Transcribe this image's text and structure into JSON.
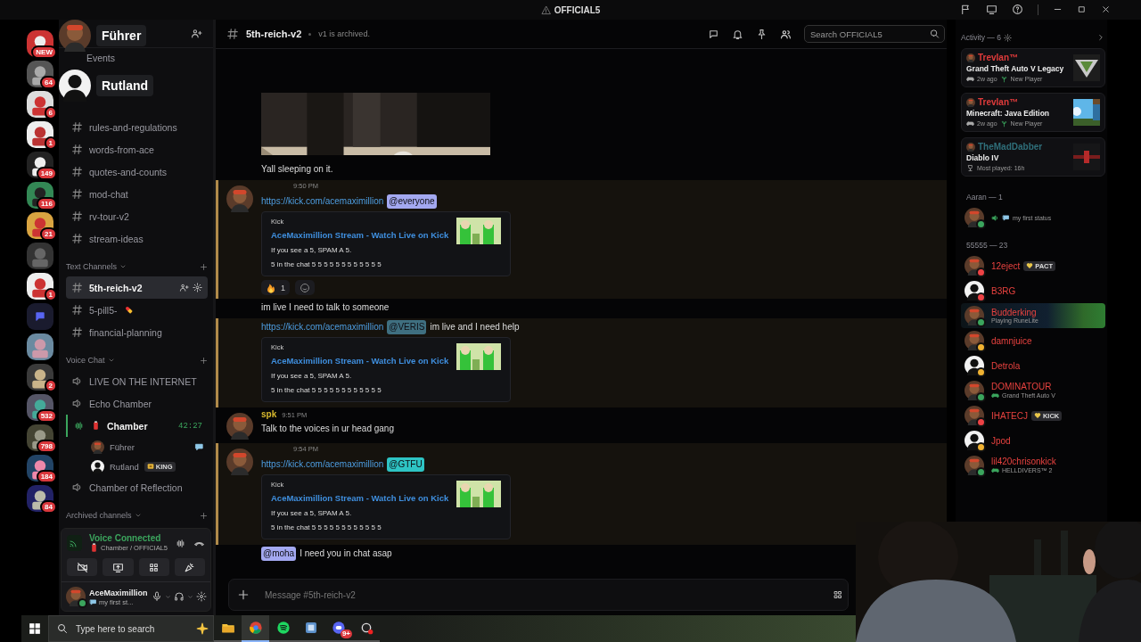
{
  "window": {
    "title": "OFFICIAL5"
  },
  "stream_overlay": {
    "speakers": [
      {
        "name": "Führer"
      },
      {
        "name": "Rutland",
        "kind": "silhouette"
      }
    ]
  },
  "servers": [
    {
      "kind": "server",
      "badge": "NEW"
    },
    {
      "kind": "server",
      "badge": "64"
    },
    {
      "kind": "server",
      "badge": "6"
    },
    {
      "kind": "server",
      "badge": "1"
    },
    {
      "kind": "server",
      "badge": "149"
    },
    {
      "kind": "server",
      "badge": "116"
    },
    {
      "kind": "server",
      "badge": "21"
    },
    {
      "kind": "server"
    },
    {
      "kind": "server",
      "badge": "1"
    },
    {
      "kind": "folder"
    },
    {
      "kind": "server"
    },
    {
      "kind": "server",
      "badge": "2"
    },
    {
      "kind": "server",
      "badge": "532"
    },
    {
      "kind": "server",
      "badge": "798"
    },
    {
      "kind": "server",
      "badge": "184"
    },
    {
      "kind": "server",
      "badge": "84"
    }
  ],
  "sidebar": {
    "events": "Events",
    "channels": [
      {
        "name": "rules-and-regulations",
        "selected": false
      },
      {
        "name": "words-from-ace",
        "selected": false
      },
      {
        "name": "quotes-and-counts",
        "selected": false
      },
      {
        "name": "mod-chat",
        "selected": false
      },
      {
        "name": "rv-tour-v2",
        "selected": false
      },
      {
        "name": "stream-ideas",
        "selected": false
      }
    ],
    "categories": [
      {
        "name": "Text Channels",
        "kind": "text",
        "channels": [
          {
            "name": "5th-reich-v2",
            "selected": true
          },
          {
            "name": "5-pill5-",
            "kind": "pill",
            "selected": false
          },
          {
            "name": "financial-planning",
            "selected": false
          }
        ]
      },
      {
        "name": "Voice Chat",
        "kind": "voice",
        "channels": [
          {
            "name": "LIVE ON THE INTERNET",
            "active": false
          },
          {
            "name": "Echo Chamber",
            "active": false
          },
          {
            "name": "Chamber",
            "kind": "battery",
            "active": true,
            "time": "42:27",
            "users": [
              {
                "name": "Führer",
                "chatting": true
              },
              {
                "name": "Rutland",
                "tag": "KING",
                "chatting": false
              }
            ]
          },
          {
            "name": "Chamber of Reflection",
            "active": false
          }
        ]
      },
      {
        "name": "Archived channels",
        "kind": "text"
      }
    ],
    "voice_panel": {
      "status": "Voice Connected",
      "location": "Chamber / OFFICIAL5"
    },
    "user": {
      "name": "AceMaximillion",
      "status": "my first st..."
    }
  },
  "chat": {
    "channel": "5th-reich-v2",
    "topic": "v1 is archived.",
    "search": {
      "placeholder": "Search OFFICIAL5"
    },
    "messages": [
      {
        "highlighted": false,
        "content": [
          {
            "kind": "text",
            "text": "Yall sleeping on it."
          }
        ]
      },
      {
        "kind": "post",
        "highlighted": true,
        "time": "9:50 PM",
        "content": [
          {
            "kind": "link",
            "text": "https://kick.com/acemaximillion"
          },
          {
            "kind": "mention",
            "text": "@everyone",
            "color": "#a3a8f0"
          }
        ],
        "embed": {
          "provider": "Kick",
          "title": "AceMaximillion Stream - Watch Live on Kick",
          "lines": [
            "If you see a 5, SPAM A 5.",
            "5 in the chat 5 5 5 5 5 5 5 5 5 5 5 5"
          ]
        },
        "reactions": [
          {
            "kind": "fire",
            "count": "1"
          }
        ]
      },
      {
        "kind": "line",
        "highlighted": false,
        "content": [
          {
            "kind": "text",
            "text": "im live I need to talk to someone"
          }
        ]
      },
      {
        "kind": "line",
        "highlighted": true,
        "content": [
          {
            "kind": "link",
            "text": "https://kick.com/acemaximillion"
          },
          {
            "kind": "mention",
            "text": "@VERIS",
            "color": "#3f6f80"
          },
          {
            "kind": "text",
            "text": "im live and I need help"
          }
        ],
        "embed": {
          "provider": "Kick",
          "title": "AceMaximillion Stream - Watch Live on Kick",
          "lines": [
            "If you see a 5, SPAM A 5.",
            "5 in the chat 5 5 5 5 5 5 5 5 5 5 5 5"
          ]
        }
      },
      {
        "kind": "post",
        "highlighted": false,
        "author": "spk",
        "color": "#d8b92e",
        "time": "9:51 PM",
        "content": [
          {
            "kind": "text",
            "text": "Talk to the voices in ur head gang"
          }
        ]
      },
      {
        "kind": "post",
        "highlighted": true,
        "time": "9:54 PM",
        "content": [
          {
            "kind": "link",
            "text": "https://kick.com/acemaximillion"
          },
          {
            "kind": "mention",
            "text": "@GTFU",
            "color": "#2ec4c4"
          }
        ],
        "embed": {
          "provider": "Kick",
          "title": "AceMaximillion Stream - Watch Live on Kick",
          "lines": [
            "If you see a 5, SPAM A 5.",
            "5 in the chat 5 5 5 5 5 5 5 5 5 5 5 5"
          ]
        }
      },
      {
        "kind": "line",
        "highlighted": false,
        "content": [
          {
            "kind": "mention",
            "text": "@moha",
            "color": "#a3a8f0"
          },
          {
            "kind": "text",
            "text": "I need you in chat asap"
          }
        ]
      }
    ],
    "composer": {
      "placeholder": "Message #5th-reich-v2"
    }
  },
  "members": {
    "activity_title": "Activity — 6",
    "activities": [
      {
        "user": "Trevlan™",
        "color": "#e03b3b",
        "kind": "gta",
        "game": "Grand Theft Auto V Legacy",
        "ago": "2w ago",
        "tag": "New Player"
      },
      {
        "user": "Trevlan™",
        "color": "#e03b3b",
        "kind": "minecraft",
        "game": "Minecraft: Java Edition",
        "ago": "2w ago",
        "tag": "New Player"
      },
      {
        "user": "TheMadDabber",
        "color": "#2f6f7a",
        "kind": "diablo",
        "game": "Diablo IV",
        "stat": "Most played: 16h"
      }
    ],
    "groups": [
      {
        "title": "Aaran — 1",
        "members": [
          {
            "color": "#3ba55d",
            "kind": "voice",
            "activity": "my first status"
          }
        ]
      },
      {
        "title": "55555 — 23",
        "members": [
          {
            "name": "12eject",
            "tag": "PACT",
            "color": "#ed4245"
          },
          {
            "name": "B3RG",
            "color": "#ed4245"
          },
          {
            "name": "Budderking",
            "color": "#3ba55d",
            "activity": "Playing RuneLite",
            "banner": true
          },
          {
            "name": "damnjuice",
            "color": "#f0b232"
          },
          {
            "name": "Detrola",
            "color": "#f0b232"
          },
          {
            "name": "DOMINATOUR",
            "color": "#3ba55d",
            "kind": "game",
            "activity": "Grand Theft Auto V"
          },
          {
            "name": "IHATECJ",
            "tag": "KICK",
            "color": "#ed4245"
          },
          {
            "name": "Jpod",
            "color": "#f0b232"
          },
          {
            "name": "lil420chrisonkick",
            "color": "#3ba55d",
            "kind": "game",
            "activity": "HELLDIVERS™ 2"
          }
        ]
      }
    ]
  },
  "taskbar": {
    "search": {
      "placeholder": "Type here to search"
    },
    "apps": [
      {
        "kind": "folder",
        "selected": false
      },
      {
        "kind": "browser",
        "selected": true
      },
      {
        "kind": "music",
        "selected": false
      },
      {
        "kind": "tool",
        "selected": false
      },
      {
        "kind": "chat",
        "badge": "9+",
        "selected": false
      },
      {
        "kind": "recorder",
        "selected": false
      }
    ]
  }
}
